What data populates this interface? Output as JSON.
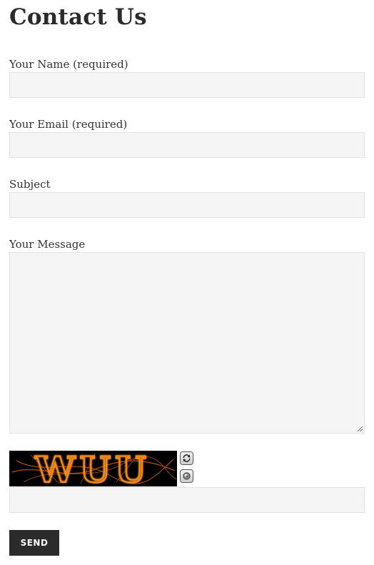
{
  "page": {
    "title": "Contact Us"
  },
  "form": {
    "name": {
      "label": "Your Name (required)",
      "value": ""
    },
    "email": {
      "label": "Your Email (required)",
      "value": ""
    },
    "subject": {
      "label": "Subject",
      "value": ""
    },
    "message": {
      "label": "Your Message",
      "value": ""
    },
    "captcha": {
      "image_text": "WUU",
      "image_colors": {
        "text": "#e8891c",
        "background": "#000000",
        "glow": "#ff6a00"
      },
      "refresh_icon": "refresh-icon",
      "audio_icon": "speaker-icon",
      "answer_value": ""
    },
    "send_label": "SEND"
  },
  "colors": {
    "input_background": "#f5f5f5",
    "input_border": "#e2e2e2",
    "button_background": "#2b2b2b",
    "button_text": "#ffffff",
    "text": "#333333"
  }
}
